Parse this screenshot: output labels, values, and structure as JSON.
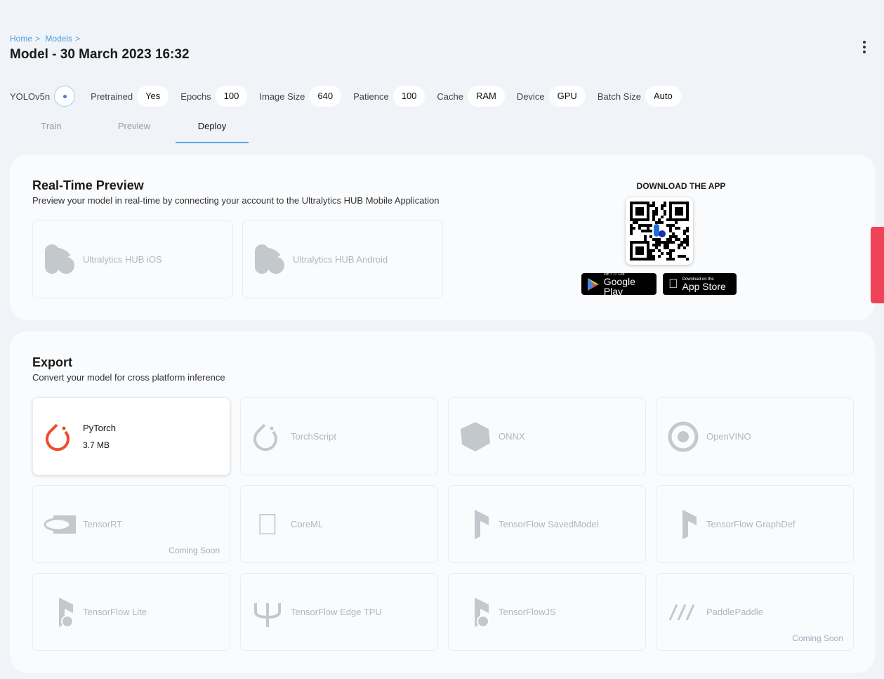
{
  "breadcrumb": [
    "Home",
    "Models"
  ],
  "title": "Model - 30 March 2023 16:32",
  "model_name": "YOLOv5n",
  "params": [
    {
      "label": "Pretrained",
      "value": "Yes"
    },
    {
      "label": "Epochs",
      "value": "100"
    },
    {
      "label": "Image Size",
      "value": "640"
    },
    {
      "label": "Patience",
      "value": "100"
    },
    {
      "label": "Cache",
      "value": "RAM"
    },
    {
      "label": "Device",
      "value": "GPU"
    },
    {
      "label": "Batch Size",
      "value": "Auto"
    }
  ],
  "tabs": [
    {
      "label": "Train"
    },
    {
      "label": "Preview"
    },
    {
      "label": "Deploy",
      "active": true
    }
  ],
  "realtime": {
    "title": "Real-Time Preview",
    "subtitle": "Preview your model in real-time by connecting your account to the Ultralytics HUB Mobile Application",
    "apps": [
      "Ultralytics HUB iOS",
      "Ultralytics HUB Android"
    ],
    "download_label": "DOWNLOAD THE APP",
    "google_play": {
      "small": "GET IT ON",
      "big": "Google Play"
    },
    "app_store": {
      "small": "Download on the",
      "big": "App Store"
    }
  },
  "export": {
    "title": "Export",
    "subtitle": "Convert your model for cross platform inference",
    "formats": [
      {
        "name": "PyTorch",
        "size": "3.7 MB",
        "icon": "pytorch-icon",
        "active": true
      },
      {
        "name": "TorchScript",
        "icon": "torchscript-icon"
      },
      {
        "name": "ONNX",
        "icon": "onnx-icon"
      },
      {
        "name": "OpenVINO",
        "icon": "openvino-icon"
      },
      {
        "name": "TensorRT",
        "icon": "nvidia-icon",
        "note": "Coming Soon"
      },
      {
        "name": "CoreML",
        "icon": "apple-icon"
      },
      {
        "name": "TensorFlow SavedModel",
        "icon": "tensorflow-icon"
      },
      {
        "name": "TensorFlow GraphDef",
        "icon": "tensorflow-icon"
      },
      {
        "name": "TensorFlow Lite",
        "icon": "tensorflow-lite-icon"
      },
      {
        "name": "TensorFlow Edge TPU",
        "icon": "edge-tpu-icon"
      },
      {
        "name": "TensorFlowJS",
        "icon": "tensorflowjs-icon"
      },
      {
        "name": "PaddlePaddle",
        "icon": "paddlepaddle-icon",
        "note": "Coming Soon"
      }
    ]
  },
  "colors": {
    "accent": "#4a9de0",
    "pytorch": "#ee4c2c",
    "feedback_tab": "#ef4458"
  }
}
